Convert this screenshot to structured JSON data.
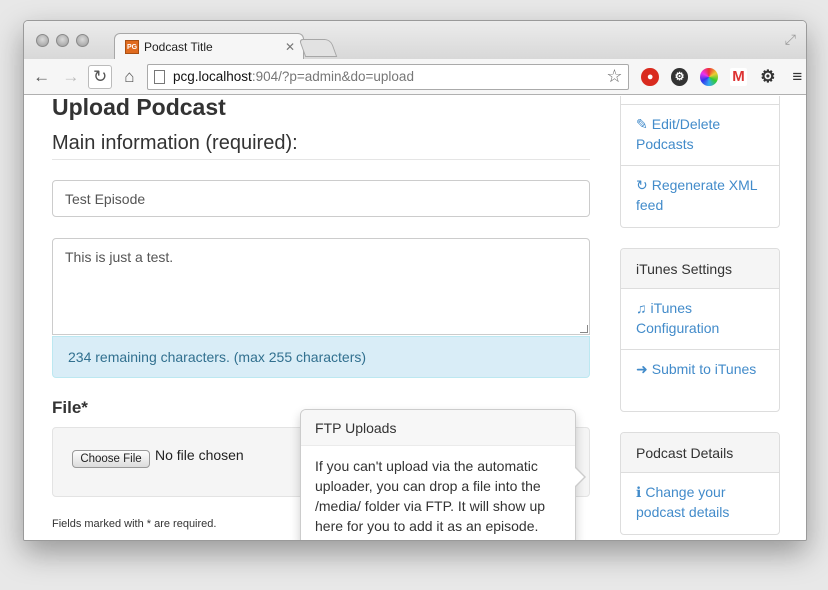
{
  "browser": {
    "tab_title": "Podcast Title",
    "favicon_text": "PG",
    "tab_close": "✕",
    "url_host": "pcg.localhost",
    "url_path": ":904/?p=admin&do=upload"
  },
  "main": {
    "heading": "Upload Podcast",
    "section_title": "Main information (required):",
    "title_value": "Test Episode",
    "description_value": "This is just a test.",
    "char_counter": "234 remaining characters. (max 255 characters)",
    "file_label": "File*",
    "choose_file_label": "Choose File",
    "no_file_text": "No file chosen",
    "help_icon_glyph": "?",
    "footnote": "Fields marked with * are required."
  },
  "popover": {
    "title": "FTP Uploads",
    "content": "If you can't upload via the automatic uploader, you can drop a file into the /media/ folder via FTP. It will show up here for you to add it as an episode."
  },
  "sidebar": {
    "top_links": [
      {
        "icon": "✎",
        "label": "Edit/Delete Podcasts"
      },
      {
        "icon": "↻",
        "label": "Regenerate XML feed"
      }
    ],
    "itunes": {
      "heading": "iTunes Settings",
      "links": [
        {
          "icon": "♫",
          "label": "iTunes Configuration"
        },
        {
          "icon": "➜",
          "label": "Submit to iTunes"
        }
      ]
    },
    "details": {
      "heading": "Podcast Details",
      "links": [
        {
          "icon": "ℹ",
          "label": "Change your podcast details"
        }
      ]
    }
  },
  "colors": {
    "link": "#428bca",
    "alert_bg": "#d9edf7",
    "alert_text": "#31708f"
  }
}
